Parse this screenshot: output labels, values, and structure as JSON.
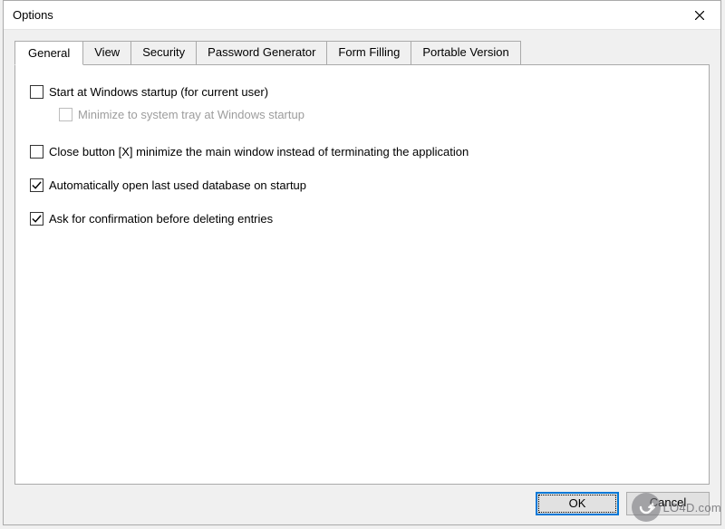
{
  "window": {
    "title": "Options"
  },
  "tabs": [
    {
      "label": "General",
      "active": true
    },
    {
      "label": "View",
      "active": false
    },
    {
      "label": "Security",
      "active": false
    },
    {
      "label": "Password Generator",
      "active": false
    },
    {
      "label": "Form Filling",
      "active": false
    },
    {
      "label": "Portable Version",
      "active": false
    }
  ],
  "options": {
    "start_at_startup": {
      "label": "Start at Windows startup (for current user)",
      "checked": false,
      "enabled": true
    },
    "minimize_tray": {
      "label": "Minimize to system tray at Windows startup",
      "checked": false,
      "enabled": false
    },
    "close_minimizes": {
      "label": "Close button [X] minimize the main window instead of terminating the application",
      "checked": false,
      "enabled": true
    },
    "open_last_db": {
      "label": "Automatically open last used database on startup",
      "checked": true,
      "enabled": true
    },
    "confirm_delete": {
      "label": "Ask for confirmation before deleting entries",
      "checked": true,
      "enabled": true
    }
  },
  "buttons": {
    "ok": "OK",
    "cancel": "Cancel"
  },
  "watermark": "LO4D.com"
}
